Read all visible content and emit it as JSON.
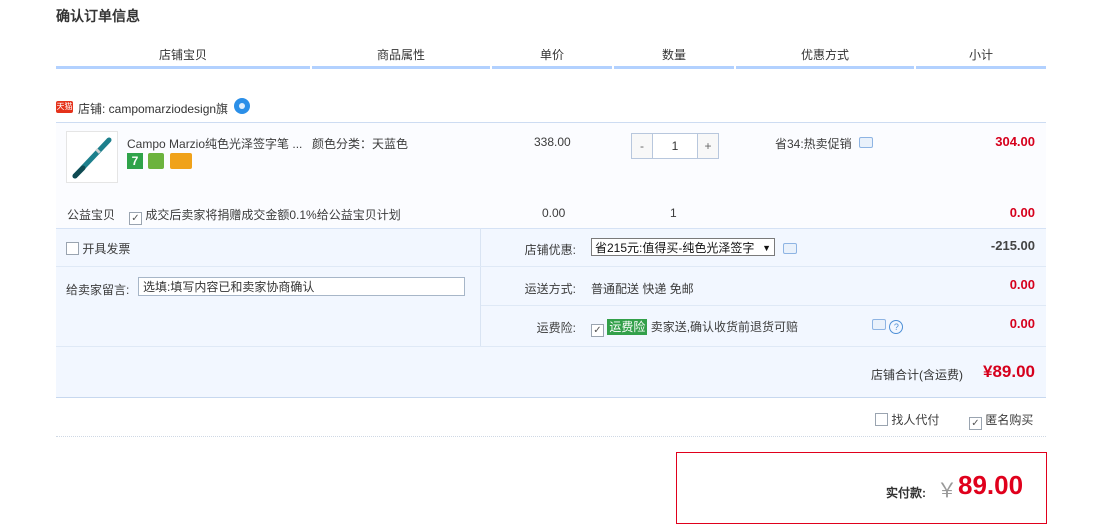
{
  "page_title": "确认订单信息",
  "columns": [
    "店铺宝贝",
    "商品属性",
    "单价",
    "数量",
    "优惠方式",
    "小计"
  ],
  "shop": {
    "badge": "天猫",
    "label": "店铺: campomarziodesign旗",
    "wangwang_icon": "wangwang-chat-icon"
  },
  "item": {
    "name": "Campo Marzio纯色光泽签字笔 ...",
    "props": "颜色分类：天蓝色",
    "price": "338.00",
    "quantity": "1",
    "qty_minus": "-",
    "qty_plus": "+",
    "promo": "省34:热卖促销",
    "subtotal": "304.00",
    "tags": [
      "7-day-return-icon",
      "service-guarantee-icon",
      "credit-card-icon"
    ]
  },
  "charity": {
    "label": "公益宝贝",
    "note": "成交后卖家将捐赠成交金额0.1%给公益宝贝计划",
    "price": "0.00",
    "quantity": "1",
    "subtotal": "0.00"
  },
  "options": {
    "invoice_label": "开具发票",
    "message_label": "给卖家留言:",
    "message_placeholder": "选填:填写内容已和卖家协商确认",
    "discount_label": "店铺优惠:",
    "discount_selected": "省215元:值得买-纯色光泽签字",
    "discount_amount": "-215.00",
    "shipping_label": "运送方式:",
    "shipping_value": "普通配送 快递 免邮",
    "shipping_amount": "0.00",
    "insurance_label": "运费险:",
    "insurance_badge": "运费险",
    "insurance_text": "卖家送,确认收货前退货可赔",
    "insurance_amount": "0.00"
  },
  "shop_total": {
    "label": "店铺合计(含运费)",
    "value": "¥89.00"
  },
  "extras": {
    "proxy_label": "找人代付",
    "anonymous_label": "匿名购买"
  },
  "payment": {
    "label": "实付款:",
    "currency": "￥",
    "value": "89.00"
  },
  "colors": {
    "price_red": "#d6001c",
    "header_line": "#b2d1ff",
    "panel_bg": "#f2f7ff",
    "pay_border": "#e0001c"
  }
}
